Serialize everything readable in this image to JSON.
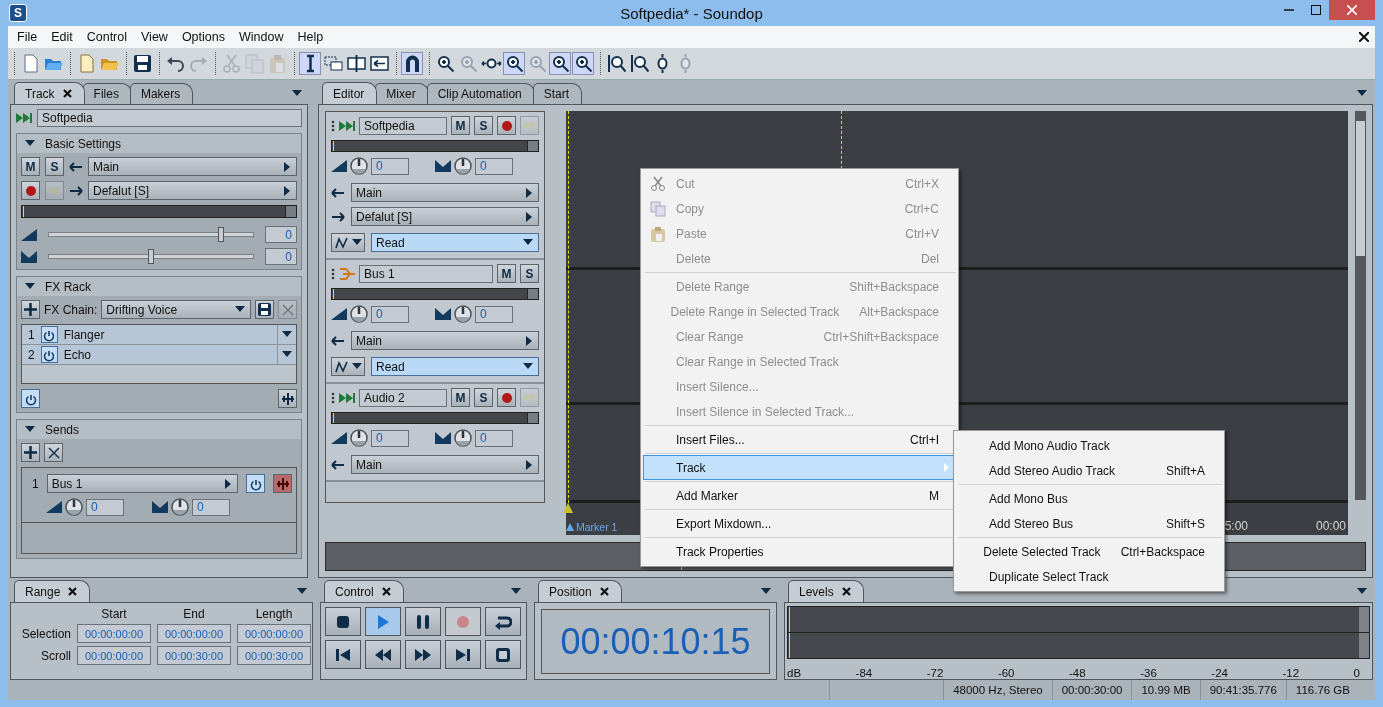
{
  "window": {
    "title": "Softpedia* - Soundop",
    "icon_letter": "S"
  },
  "menu_bar": [
    "File",
    "Edit",
    "Control",
    "View",
    "Options",
    "Window",
    "Help"
  ],
  "toolbar": {
    "groups": [
      [
        {
          "kind": "new-file",
          "selected": false,
          "disabled": false
        },
        {
          "kind": "open-file",
          "selected": false,
          "disabled": false
        }
      ],
      [
        {
          "kind": "new-project",
          "selected": false,
          "disabled": false
        },
        {
          "kind": "open-project",
          "selected": false,
          "disabled": false
        }
      ],
      [
        {
          "kind": "save",
          "selected": false,
          "disabled": false
        }
      ],
      [
        {
          "kind": "undo",
          "selected": false,
          "disabled": false
        },
        {
          "kind": "redo",
          "selected": false,
          "disabled": true
        }
      ],
      [
        {
          "kind": "cut",
          "selected": false,
          "disabled": true
        },
        {
          "kind": "copy",
          "selected": false,
          "disabled": true
        },
        {
          "kind": "paste",
          "selected": false,
          "disabled": true
        }
      ],
      [
        {
          "kind": "ibeam",
          "selected": true,
          "disabled": false
        },
        {
          "kind": "range",
          "selected": false,
          "disabled": false
        },
        {
          "kind": "split",
          "selected": false,
          "disabled": false
        },
        {
          "kind": "slip",
          "selected": false,
          "disabled": false
        }
      ],
      [
        {
          "kind": "magnet",
          "selected": true,
          "disabled": false
        }
      ],
      [
        {
          "kind": "zoom",
          "selected": false,
          "disabled": false
        },
        {
          "kind": "zoom",
          "selected": false,
          "disabled": true
        },
        {
          "kind": "zoom-width",
          "selected": false,
          "disabled": false
        },
        {
          "kind": "zoom",
          "selected": true,
          "disabled": false
        },
        {
          "kind": "zoom",
          "selected": false,
          "disabled": true
        },
        {
          "kind": "zoom",
          "selected": true,
          "disabled": false
        },
        {
          "kind": "zoom",
          "selected": true,
          "disabled": false
        }
      ],
      [
        {
          "kind": "zoom-vertical",
          "selected": false,
          "disabled": false
        },
        {
          "kind": "zoom-vertical",
          "selected": false,
          "disabled": false
        },
        {
          "kind": "zoom-height",
          "selected": false,
          "disabled": false
        },
        {
          "kind": "zoom-height",
          "selected": false,
          "disabled": true
        }
      ]
    ]
  },
  "left_panel": {
    "tabs": [
      {
        "label": "Track",
        "selected": true,
        "closable": true
      },
      {
        "label": "Files",
        "selected": false,
        "closable": false
      },
      {
        "label": "Makers",
        "selected": false,
        "closable": false
      }
    ],
    "track_name": "Softpedia",
    "basic_settings": {
      "title": "Basic Settings",
      "mute": "M",
      "solo": "S",
      "input": "Main",
      "output": "Defalut [S]",
      "volume": {
        "level": 0.84,
        "reading": "0"
      },
      "pan": {
        "level": 0.5,
        "reading": "0"
      }
    },
    "fx_rack": {
      "title": "FX Rack",
      "chain_label": "FX Chain:",
      "chain": "Drifting Voice",
      "effects": [
        {
          "index": "1",
          "name": "Flanger",
          "on": true
        },
        {
          "index": "2",
          "name": "Echo",
          "on": true
        }
      ]
    },
    "sends": {
      "title": "Sends",
      "items": [
        {
          "index": "1",
          "target": "Bus 1",
          "volume": "0",
          "pan": "0"
        }
      ]
    }
  },
  "editor": {
    "tabs": [
      {
        "label": "Editor",
        "selected": true
      },
      {
        "label": "Mixer",
        "selected": false
      },
      {
        "label": "Clip Automation",
        "selected": false
      },
      {
        "label": "Start",
        "selected": false
      }
    ],
    "tracks": [
      {
        "kind": "audio",
        "name": "Softpedia",
        "mute": "M",
        "solo": "S",
        "volume": "0",
        "pan": "0",
        "input": "Main",
        "output": "Defalut [S]",
        "automation": "Read"
      },
      {
        "kind": "bus",
        "name": "Bus 1",
        "mute": "M",
        "solo": "S",
        "volume": "0",
        "pan": "0",
        "input": "Main",
        "automation": "Read"
      },
      {
        "kind": "audio",
        "name": "Audio 2",
        "mute": "M",
        "solo": "S",
        "volume": "0",
        "pan": "0",
        "input": "Main"
      }
    ],
    "marker": "Marker 1",
    "time_labels": [
      "5:00",
      "00:00"
    ]
  },
  "context_menu": [
    {
      "kind": "cut",
      "label": "Cut",
      "shortcut": "Ctrl+X",
      "disabled": true,
      "selected": false
    },
    {
      "kind": "copy",
      "label": "Copy",
      "shortcut": "Ctrl+C",
      "disabled": true,
      "selected": false
    },
    {
      "kind": "paste",
      "label": "Paste",
      "shortcut": "Ctrl+V",
      "disabled": true,
      "selected": false
    },
    {
      "kind": "item",
      "label": "Delete",
      "shortcut": "Del",
      "disabled": true,
      "selected": false
    },
    {
      "kind": "separator"
    },
    {
      "kind": "item",
      "label": "Delete Range",
      "shortcut": "Shift+Backspace",
      "disabled": true,
      "selected": false
    },
    {
      "kind": "item",
      "label": "Delete Range in Selected Track",
      "shortcut": "Alt+Backspace",
      "disabled": true,
      "selected": false
    },
    {
      "kind": "item",
      "label": "Clear Range",
      "shortcut": "Ctrl+Shift+Backspace",
      "disabled": true,
      "selected": false
    },
    {
      "kind": "item",
      "label": "Clear Range in Selected Track",
      "disabled": true,
      "selected": false
    },
    {
      "kind": "item",
      "label": "Insert Silence...",
      "disabled": true,
      "selected": false
    },
    {
      "kind": "item",
      "label": "Insert Silence in Selected Track...",
      "disabled": true,
      "selected": false
    },
    {
      "kind": "separator"
    },
    {
      "kind": "item",
      "label": "Insert Files...",
      "shortcut": "Ctrl+I",
      "disabled": false,
      "selected": false
    },
    {
      "kind": "separator"
    },
    {
      "kind": "submenu",
      "label": "Track",
      "disabled": false,
      "selected": true
    },
    {
      "kind": "separator"
    },
    {
      "kind": "item",
      "label": "Add Marker",
      "shortcut": "M",
      "disabled": false,
      "selected": false
    },
    {
      "kind": "separator"
    },
    {
      "kind": "item",
      "label": "Export Mixdown...",
      "disabled": false,
      "selected": false
    },
    {
      "kind": "separator"
    },
    {
      "kind": "item",
      "label": "Track Properties",
      "disabled": false,
      "selected": false
    }
  ],
  "submenu": [
    {
      "kind": "item",
      "label": "Add Mono Audio Track"
    },
    {
      "kind": "item",
      "label": "Add Stereo Audio Track",
      "shortcut": "Shift+A"
    },
    {
      "kind": "separator"
    },
    {
      "kind": "item",
      "label": "Add Mono Bus"
    },
    {
      "kind": "item",
      "label": "Add Stereo Bus",
      "shortcut": "Shift+S"
    },
    {
      "kind": "separator"
    },
    {
      "kind": "item",
      "label": "Delete Selected Track",
      "shortcut": "Ctrl+Backspace"
    },
    {
      "kind": "item",
      "label": "Duplicate Select Track"
    }
  ],
  "range_panel": {
    "tab": "Range",
    "headers": [
      "Start",
      "End",
      "Length"
    ],
    "rows": [
      {
        "label": "Selection",
        "values": [
          "00:00:00:00",
          "00:00:00:00",
          "00:00:00:00"
        ]
      },
      {
        "label": "Scroll",
        "values": [
          "00:00:00:00",
          "00:00:30:00",
          "00:00:30:00"
        ]
      }
    ]
  },
  "control_panel": {
    "tab": "Control",
    "buttons": [
      {
        "kind": "stop",
        "selected": false,
        "disabled": false
      },
      {
        "kind": "play",
        "selected": true,
        "disabled": false
      },
      {
        "kind": "pause",
        "selected": false,
        "disabled": false
      },
      {
        "kind": "record",
        "selected": false,
        "disabled": true
      },
      {
        "kind": "loop",
        "selected": false,
        "disabled": false
      },
      {
        "kind": "to-start",
        "selected": false,
        "disabled": false
      },
      {
        "kind": "rewind",
        "selected": false,
        "disabled": false
      },
      {
        "kind": "forward",
        "selected": false,
        "disabled": false
      },
      {
        "kind": "to-end",
        "selected": false,
        "disabled": false
      },
      {
        "kind": "record-stop",
        "selected": false,
        "disabled": false
      }
    ]
  },
  "position_panel": {
    "tab": "Position",
    "time": "00:00:10:15"
  },
  "levels_panel": {
    "tab": "Levels",
    "scale": [
      "dB",
      "-84",
      "-72",
      "-60",
      "-48",
      "-36",
      "-24",
      "-12",
      "0"
    ]
  },
  "status_bar": [
    "48000 Hz, Stereo",
    "00:00:30:00",
    "10.99 MB",
    "90:41:35.776",
    "116.76 GB"
  ]
}
